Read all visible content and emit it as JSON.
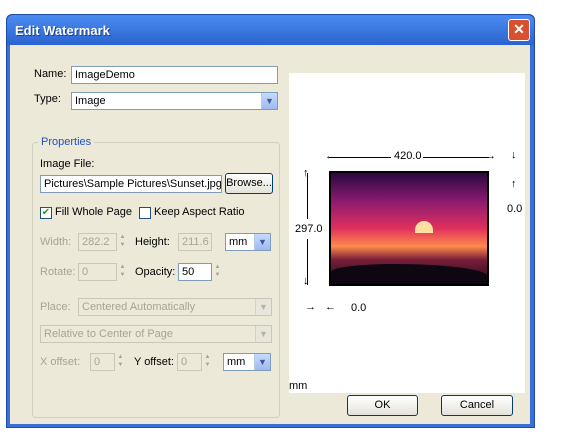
{
  "window": {
    "title": "Edit Watermark"
  },
  "name": {
    "label": "Name:",
    "value": "ImageDemo"
  },
  "type": {
    "label": "Type:",
    "value": "Image"
  },
  "properties": {
    "title": "Properties",
    "image_file_label": "Image File:",
    "image_file_value": "Pictures\\Sample Pictures\\Sunset.jpg",
    "browse_label": "Browse...",
    "fill_whole_page_label": "Fill Whole Page",
    "fill_whole_page_checked": true,
    "keep_aspect_label": "Keep Aspect Ratio",
    "keep_aspect_checked": false,
    "width_label": "Width:",
    "width_value": "282.2",
    "height_label": "Height:",
    "height_value": "211.6",
    "size_unit": "mm",
    "rotate_label": "Rotate:",
    "rotate_value": "0",
    "opacity_label": "Opacity:",
    "opacity_value": "50",
    "place_label": "Place:",
    "place_value": "Centered Automatically",
    "relative_value": "Relative to Center of Page",
    "xoffset_label": "X offset:",
    "xoffset_value": "0",
    "yoffset_label": "Y offset:",
    "yoffset_value": "0",
    "offset_unit": "mm"
  },
  "preview": {
    "width_dim": "420.0",
    "height_dim": "297.0",
    "top_offset": "0.0",
    "left_offset": "0.0",
    "unit": "mm"
  },
  "buttons": {
    "ok": "OK",
    "cancel": "Cancel"
  },
  "icons": {
    "close": "close-icon",
    "dropdown": "chevron-down-icon"
  }
}
